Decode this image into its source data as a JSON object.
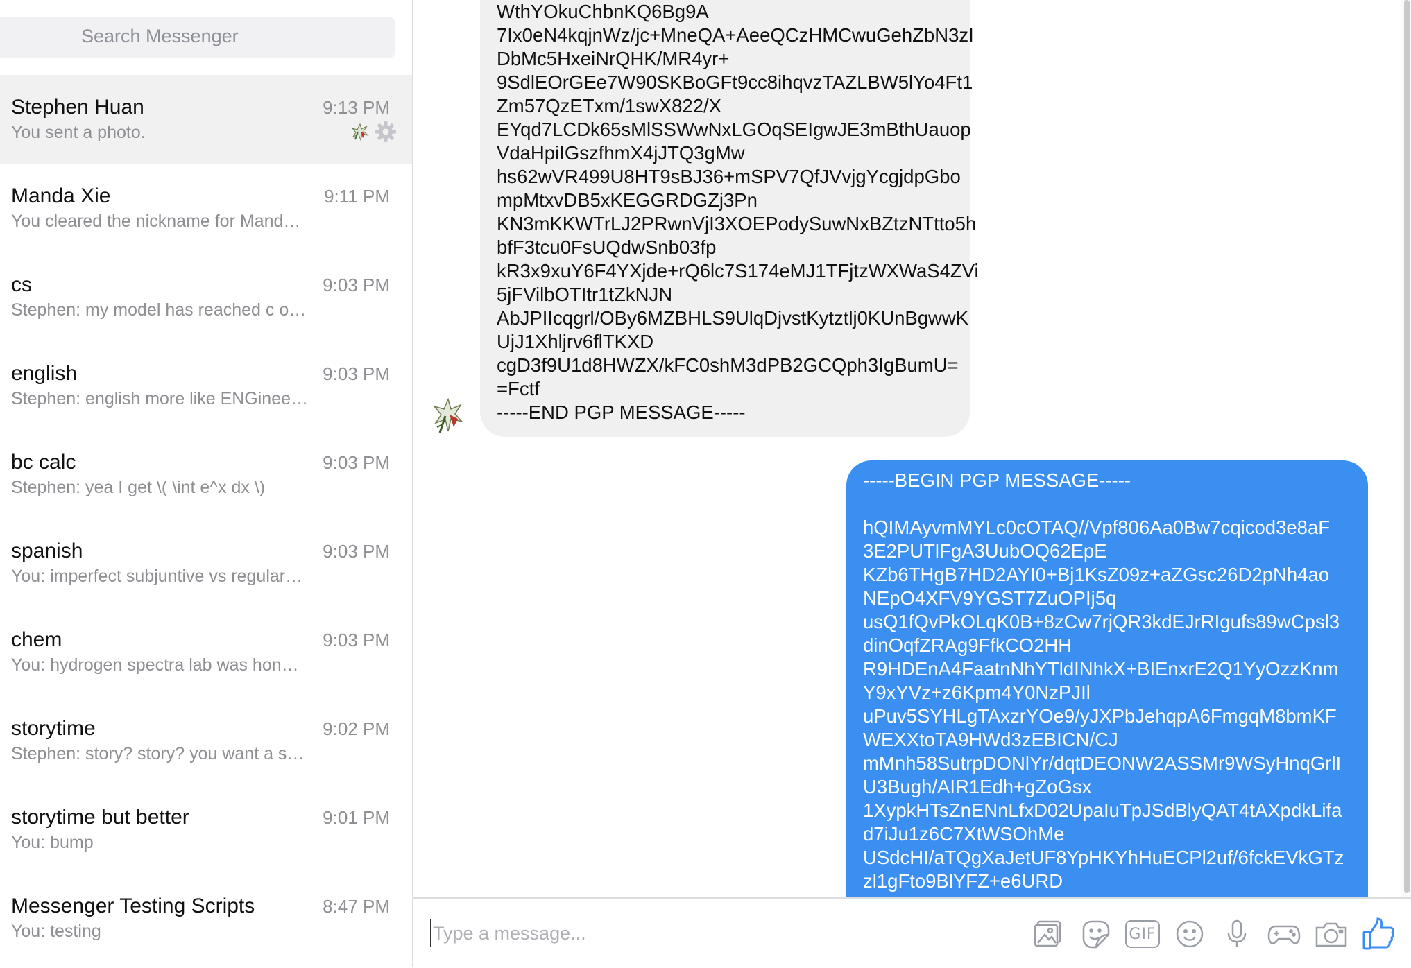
{
  "search": {
    "placeholder": "Search Messenger"
  },
  "conversations": [
    {
      "name": "Stephen Huan",
      "time": "9:13 PM",
      "snippet": "You sent a photo."
    },
    {
      "name": "Manda Xie",
      "time": "9:11 PM",
      "snippet": "You cleared the nickname for Mand…"
    },
    {
      "name": "cs",
      "time": "9:03 PM",
      "snippet": "Stephen: my model has reached c o…"
    },
    {
      "name": "english",
      "time": "9:03 PM",
      "snippet": "Stephen: english more like ENGinee…"
    },
    {
      "name": "bc calc",
      "time": "9:03 PM",
      "snippet": "Stephen: yea I get \\( \\int e^x dx \\)"
    },
    {
      "name": "spanish",
      "time": "9:03 PM",
      "snippet": "You: imperfect subjuntive vs regular…"
    },
    {
      "name": "chem",
      "time": "9:03 PM",
      "snippet": "You: hydrogen spectra lab was hon…"
    },
    {
      "name": "storytime",
      "time": "9:02 PM",
      "snippet": "Stephen: story? story? you want a s…"
    },
    {
      "name": "storytime but better",
      "time": "9:01 PM",
      "snippet": "You: bump"
    },
    {
      "name": "Messenger Testing Scripts",
      "time": "8:47 PM",
      "snippet": "You: testing"
    }
  ],
  "incoming_message": {
    "lines": [
      "WthYOkuChbnKQ6Bg9A",
      "7Ix0eN4kqjnWz/jc+MneQA+AeeQCzHMCwuGehZbN3zI",
      "DbMc5HxeiNrQHK/MR4yr+",
      "9SdlEOrGEe7W90SKBoGFt9cc8ihqvzTAZLBW5lYo4Ft1",
      "Zm57QzETxm/1swX822/X",
      "EYqd7LCDk65sMlSSWwNxLGOqSEIgwJE3mBthUauop",
      "VdaHpiIGszfhmX4jJTQ3gMw",
      "hs62wVR499U8HT9sBJ36+mSPV7QfJVvjgYcgjdpGbo",
      "mpMtxvDB5xKEGGRDGZj3Pn",
      "KN3mKKWTrLJ2PRwnVjI3XOEPodySuwNxBZtzNTtto5h",
      "bfF3tcu0FsUQdwSnb03fp",
      "kR3x9xuY6F4YXjde+rQ6lc7S174eMJ1TFjtzWXWaS4ZVi",
      "5jFVilbOTItr1tZkNJN",
      "AbJPIIcqgrl/OBy6MZBHLS9UlqDjvstKytztlj0KUnBgwwK",
      "UjJ1Xhljrv6flTKXD",
      "cgD3f9U1d8HWZX/kFC0shM3dPB2GCQph3IgBumU=",
      "=Fctf",
      "-----END PGP MESSAGE-----"
    ]
  },
  "outgoing_message": {
    "lines": [
      "-----BEGIN PGP MESSAGE-----",
      "",
      "hQIMAyvmMYLc0cOTAQ//Vpf806Aa0Bw7cqicod3e8aF",
      "3E2PUTlFgA3UubOQ62EpE",
      "KZb6THgB7HD2AYI0+Bj1KsZ09z+aZGsc26D2pNh4ao",
      "NEpO4XFV9YGST7ZuOPIj5q",
      "usQ1fQvPkOLqK0B+8zCw7rjQR3kdEJrRIgufs89wCpsl3",
      "dinOqfZRAg9FfkCO2HH",
      "R9HDEnA4FaatnNhYTldINhkX+BIEnxrE2Q1YyOzzKnm",
      "Y9xYVz+z6Kpm4Y0NzPJIl",
      "uPuv5SYHLgTAxzrYOe9/yJXPbJehqpA6FmgqM8bmKF",
      "WEXXtoTA9HWd3zEBICN/CJ",
      "mMnh58SutrpDONlYr/dqtDEONW2ASSMr9WSyHnqGrlI",
      "U3Bugh/AIR1Edh+gZoGsx",
      "1XypkHTsZnENnLfxD02UpaIuTpJSdBlyQAT4tAXpdkLifa",
      "d7iJu1z6C7XtWSOhMe",
      "USdcHI/aTQgXaJetUF8YpHKYhHuECPl2uf/6fckEVkGTz",
      "zl1gFto9BlYFZ+e6URD"
    ]
  },
  "composer": {
    "placeholder": "Type a message..."
  },
  "colors": {
    "accent": "#3a8ff0",
    "incoming_bubble": "#f0f0f0",
    "active_row": "#f1f1f2"
  },
  "toolbar_icons": [
    "photo-icon",
    "sticker-icon",
    "gif-icon",
    "emoji-icon",
    "microphone-icon",
    "game-controller-icon",
    "camera-icon",
    "thumbs-up-icon"
  ],
  "toolbar": {
    "gif_label": "GIF"
  }
}
